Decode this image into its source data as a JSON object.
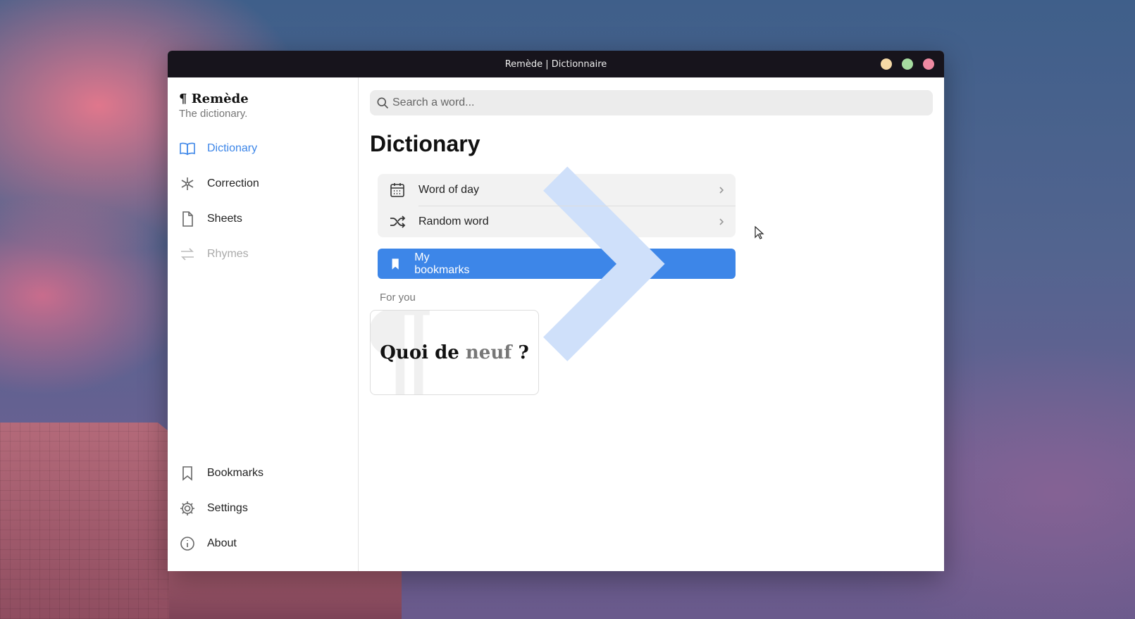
{
  "window": {
    "title": "Remède | Dictionnaire"
  },
  "sidebar": {
    "brand": "¶ Remède",
    "tagline": "The dictionary.",
    "items": [
      {
        "label": "Dictionary",
        "icon": "book-icon",
        "state": "active"
      },
      {
        "label": "Correction",
        "icon": "asterisk-icon",
        "state": "normal"
      },
      {
        "label": "Sheets",
        "icon": "file-icon",
        "state": "normal"
      },
      {
        "label": "Rhymes",
        "icon": "arrows-swap-icon",
        "state": "disabled"
      }
    ],
    "bottom_items": [
      {
        "label": "Bookmarks",
        "icon": "bookmark-icon"
      },
      {
        "label": "Settings",
        "icon": "gear-icon"
      },
      {
        "label": "About",
        "icon": "info-icon"
      }
    ]
  },
  "search": {
    "placeholder": "Search a word..."
  },
  "main": {
    "title": "Dictionary",
    "rows": [
      {
        "label": "Word of day",
        "icon": "calendar-icon"
      },
      {
        "label": "Random word",
        "icon": "shuffle-icon"
      }
    ],
    "bookmarks_button": {
      "label": "My bookmarks",
      "icon": "bookmark-filled-icon"
    },
    "section_label": "For you",
    "card": {
      "mark": "¶",
      "text_start": "Quoi de ",
      "text_highlight": "neuf",
      "text_end": " ?"
    }
  },
  "colors": {
    "accent": "#3d86e8",
    "titlebar": "#17141c"
  }
}
